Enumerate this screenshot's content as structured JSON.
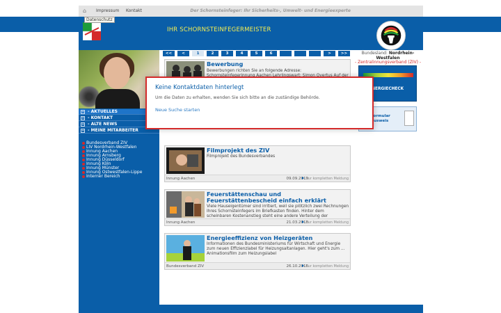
{
  "topnav": {
    "impressum": "Impressum",
    "kontakt": "Kontakt",
    "tooltip": "Datenschutz",
    "slogan": "Der Schornsteinfeger: Ihr Sicherheits-, Umwelt- und Energieexperte"
  },
  "header": {
    "title": "IHR SCHORNSTEINFEGERMEISTER"
  },
  "menu": [
    {
      "label": "- AKTUELLES"
    },
    {
      "label": "- KONTAKT"
    },
    {
      "label": "- ALTE NEWS"
    },
    {
      "label": "- MEINE MITARBEITER"
    }
  ],
  "links": [
    "Bundesverband ZIV",
    "LIV Nordrhein-Westfalen",
    "Innung Aachen",
    "Innung Arnsberg",
    "Innung Düsseldorf",
    "Innung Köln",
    "Innung Münster",
    "Innung Ostwestfalen-Lippe",
    "Interner Bereich"
  ],
  "pager": {
    "first": "<<",
    "prev": "<",
    "pages": [
      "1",
      "2",
      "3",
      "4",
      "5",
      "6"
    ],
    "next": ">",
    "last": ">>",
    "current": "1"
  },
  "news": [
    {
      "title": "Bewerbung",
      "desc": "Bewerbungen richten Sie an folgende Adresse: Schornsteinfegerinnung Aachen Lehrlingswart: Simon Overtus Auf der Hüls 199 52068 Aachen",
      "source": "",
      "date": "",
      "more": ""
    },
    {
      "title": "Filmprojekt des ZIV",
      "desc": "Filmprojekt des Bundesverbandes",
      "source": "Innung Aachen",
      "date": "09.09.2019",
      "more": "Zur kompletten Meldung"
    },
    {
      "title": "Feuerstättenschau und Feuerstättenbescheid einfach erklärt",
      "desc": "Viele Hauseigentümer sind irritiert, weil sie plötzlich zwei Rechnungen Ihres Schornsteinfegers im Briefkasten finden. Hinter dem scheinbaren Kostenanstieg steht eine andere Verteilung der Gebühren.",
      "source": "Innung Aachen",
      "date": "21.03.2018",
      "more": "Zur kompletten Meldung"
    },
    {
      "title": "Energieeffizienz von Heizgeräten",
      "desc": "Informationen des Bundesministeriums für Wirtschaft und Energie zum neuen Effizienzlabel für Heizungsaltanlagen. Hier geht's zum ... Animationsfilm zum Heizungslabel",
      "source": "Bundesverband ZIV",
      "date": "26.10.2016",
      "more": "Zur kompletten Meldung"
    }
  ],
  "right": {
    "state_prefix": "Bundesland: ",
    "state": "Nordrhein-Westfalen",
    "ziv": "- Zentralinnungsverband (ZIV) -",
    "energy_label": "NE-ENERGIECHECK",
    "form_label_1": "ungsformular",
    "form_label_2": "uchsausweis"
  },
  "modal": {
    "title": "Keine Kontaktdaten hinterlegt",
    "text": "Um die Daten zu erhalten, wenden Sie sich bitte an die zuständige Behörde.",
    "link": "Neue Suche starten"
  },
  "colors": {
    "brand_blue": "#0a5ea8",
    "title_yellow": "#f5ee52",
    "alert_red": "#d42a2a"
  }
}
